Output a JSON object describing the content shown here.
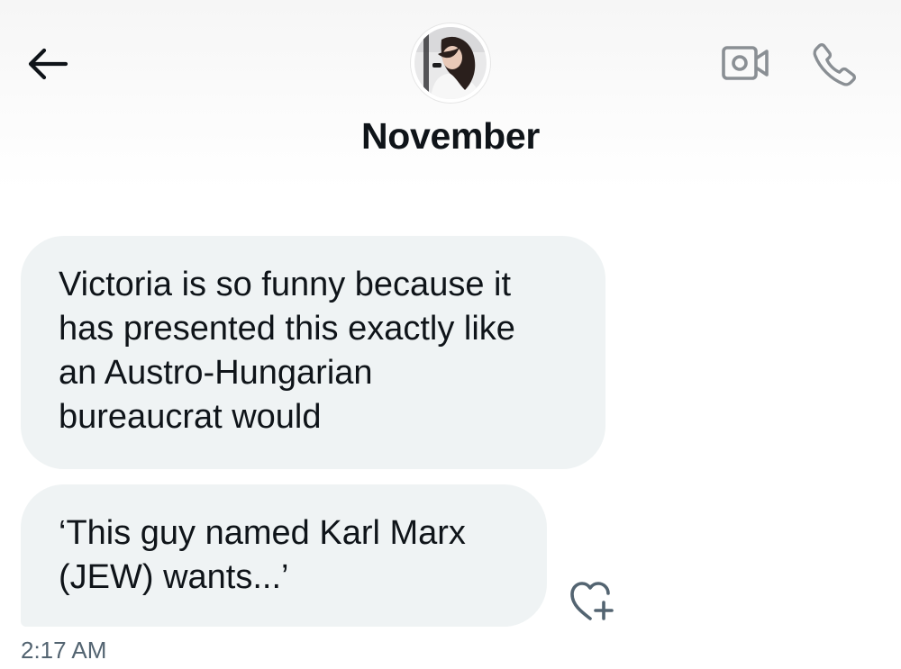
{
  "header": {
    "title": "November",
    "back_icon": "arrow-left-icon",
    "video_icon": "video-camera-icon",
    "call_icon": "phone-icon",
    "icon_color": "#0f1419",
    "action_icon_color": "#8a8f94"
  },
  "messages": [
    {
      "text": "Victoria is so funny because it\nhas presented this exactly like\nan Austro-Hungarian\nbureaucrat would"
    },
    {
      "text": "‘This guy named Karl Marx\n(JEW) wants...’"
    }
  ],
  "reaction": {
    "icon": "heart-plus-icon"
  },
  "timestamp": "2:17 AM",
  "colors": {
    "bubble": "#eff3f4",
    "text": "#0f1419",
    "secondary_text": "#536471"
  }
}
